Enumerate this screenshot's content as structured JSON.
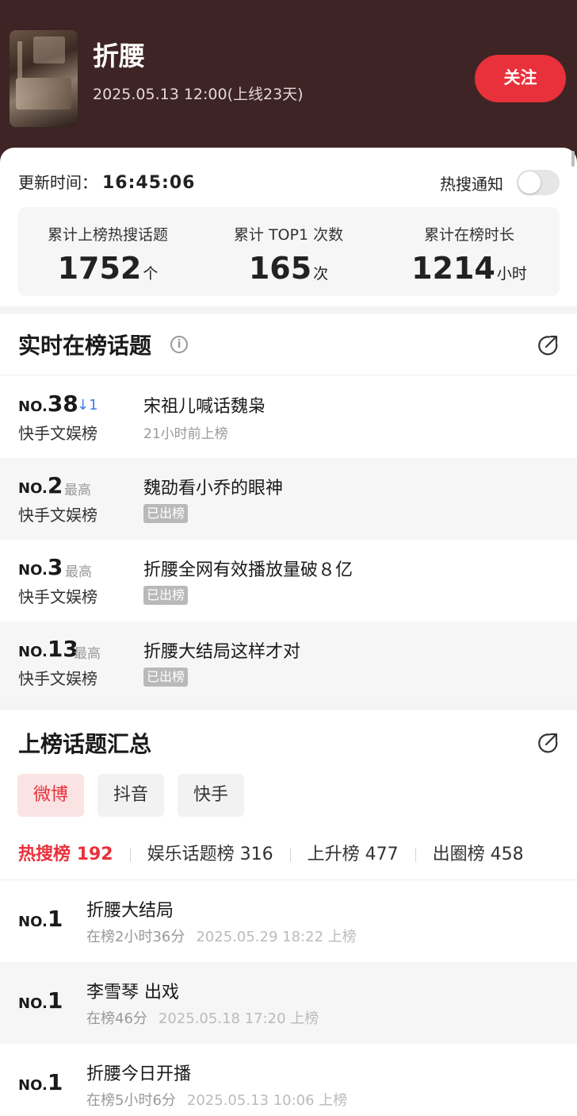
{
  "header": {
    "title": "折腰",
    "subtitle": "2025.05.13 12:00(上线23天)",
    "follow_label": "关注",
    "bg_color": "#3e2424",
    "accent_color": "#e8313a"
  },
  "stats": {
    "update_label": "更新时间：",
    "update_time": "16:45:06",
    "notify_label": "热搜通知",
    "notify_on": false,
    "items": [
      {
        "label": "累计上榜热搜话题",
        "value": "1752",
        "unit": "个"
      },
      {
        "label": "累计 TOP1 次数",
        "value": "165",
        "unit": "次"
      },
      {
        "label": "累计在榜时长",
        "value": "1214",
        "unit": "小时"
      }
    ]
  },
  "realtime": {
    "title": "实时在榜话题",
    "rows": [
      {
        "no": "NO.",
        "rank": "38",
        "note": "↓1",
        "board": "快手文娱榜",
        "topic": "宋祖儿喊话魏枭",
        "sub": "21小时前上榜",
        "status": ""
      },
      {
        "no": "NO.",
        "rank": "2",
        "note": "最高",
        "board": "快手文娱榜",
        "topic": "魏劭看小乔的眼神",
        "sub": "",
        "status": "已出榜"
      },
      {
        "no": "NO.",
        "rank": "3",
        "note": "最高",
        "board": "快手文娱榜",
        "topic": "折腰全网有效播放量破８亿",
        "sub": "",
        "status": "已出榜"
      },
      {
        "no": "NO.",
        "rank": "13",
        "note": "最高",
        "board": "快手文娱榜",
        "topic": "折腰大结局这样才对",
        "sub": "",
        "status": "已出榜"
      }
    ]
  },
  "summary": {
    "title": "上榜话题汇总",
    "platforms": [
      "微博",
      "抖音",
      "快手"
    ],
    "active_platform": "微博",
    "categories": [
      {
        "label": "热搜榜",
        "count": "192"
      },
      {
        "label": "娱乐话题榜",
        "count": "316"
      },
      {
        "label": "上升榜",
        "count": "477"
      },
      {
        "label": "出圈榜",
        "count": "458"
      }
    ],
    "rows": [
      {
        "no": "NO.",
        "rank": "1",
        "topic": "折腰大结局",
        "duration": "在榜2小时36分",
        "date": "2025.05.29 18:22 上榜"
      },
      {
        "no": "NO.",
        "rank": "1",
        "topic": "李雪琴 出戏",
        "duration": "在榜46分",
        "date": "2025.05.18 17:20 上榜"
      },
      {
        "no": "NO.",
        "rank": "1",
        "topic": "折腰今日开播",
        "duration": "在榜5小时6分",
        "date": "2025.05.13 10:06 上榜"
      }
    ]
  }
}
